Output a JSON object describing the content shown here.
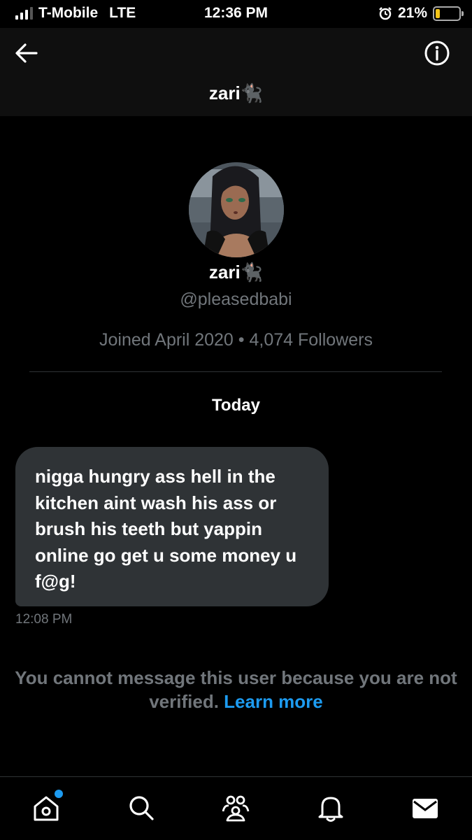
{
  "status_bar": {
    "carrier": "T-Mobile",
    "network": "LTE",
    "time": "12:36 PM",
    "battery_percent_label": "21%",
    "battery_level": 0.21
  },
  "header": {
    "title": "zari🐈‍⬛",
    "back_icon": "back-arrow-icon",
    "info_icon": "info-icon"
  },
  "profile": {
    "name": "zari🐈‍⬛",
    "handle": "@pleasedbabi",
    "meta": "Joined April 2020 • 4,074 Followers"
  },
  "conversation": {
    "date_label": "Today",
    "messages": [
      {
        "text": "nigga hungry ass hell in the kitchen aint wash his ass or brush his teeth but yappin online go get u some money u f@g!",
        "time": "12:08 PM"
      }
    ]
  },
  "notice": {
    "text": "You cannot message this user because you are not verified. ",
    "link": "Learn more"
  },
  "tab_bar": {
    "items": [
      "home-icon",
      "search-icon",
      "communities-icon",
      "notifications-icon",
      "messages-icon"
    ]
  },
  "colors": {
    "accent": "#1d9bf0",
    "bubble": "#2f3336",
    "muted": "#71767b"
  }
}
